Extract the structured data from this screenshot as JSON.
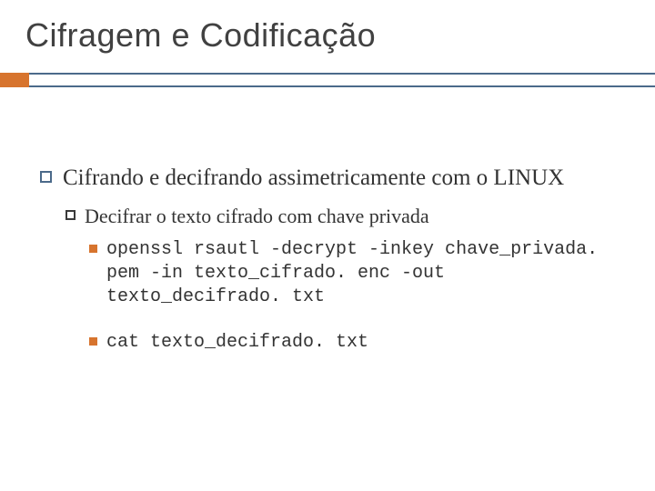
{
  "title": "Cifragem e Codificação",
  "lvl1_text": "Cifrando e decifrando assimetricamente com o LINUX",
  "lvl2_text": "Decifrar o texto cifrado com chave privada",
  "lvl3_a": "openssl rsautl -decrypt -inkey chave_privada. pem -in texto_cifrado. enc -out texto_decifrado. txt",
  "lvl3_b": "cat texto_decifrado. txt"
}
